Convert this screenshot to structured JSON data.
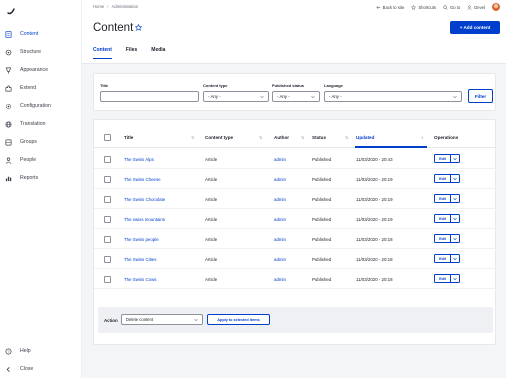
{
  "sidebar": {
    "items": [
      {
        "label": "Content",
        "icon": "file-icon",
        "active": true
      },
      {
        "label": "Structure",
        "icon": "structure-icon",
        "active": false
      },
      {
        "label": "Appearance",
        "icon": "brush-icon",
        "active": false
      },
      {
        "label": "Extend",
        "icon": "puzzle-icon",
        "active": false
      },
      {
        "label": "Configuration",
        "icon": "wrench-icon",
        "active": false
      },
      {
        "label": "Translation",
        "icon": "globe-icon",
        "active": false
      },
      {
        "label": "Groups",
        "icon": "groups-icon",
        "active": false
      },
      {
        "label": "People",
        "icon": "person-icon",
        "active": false
      },
      {
        "label": "Reports",
        "icon": "chart-icon",
        "active": false
      }
    ],
    "bottom": [
      {
        "label": "Help",
        "icon": "help-icon"
      },
      {
        "label": "Close",
        "icon": "close-icon"
      }
    ]
  },
  "topbar": {
    "breadcrumb": [
      "Home",
      "›",
      "Administration"
    ],
    "back_to_site": "Back to site",
    "shortcuts": "Shortcuts",
    "goto": "Go to",
    "user": "Devel"
  },
  "header": {
    "title": "Content",
    "add_button": "+ Add content",
    "tabs": [
      "Content",
      "Files",
      "Media"
    ]
  },
  "filters": {
    "title_label": "Title",
    "title_value": "",
    "content_type_label": "Content type",
    "content_type_value": "- Any -",
    "published_label": "Published status",
    "published_value": "- Any -",
    "language_label": "Language",
    "language_value": "- Any -",
    "filter_button": "Filter"
  },
  "table": {
    "columns": [
      "Title",
      "Content type",
      "Author",
      "Status",
      "Updated",
      "Operations"
    ],
    "sorted_arrow": "↑",
    "rows": [
      {
        "title": "The Swiss Alps",
        "type": "Article",
        "author": "admin",
        "status": "Published",
        "updated": "11/03/2020 - 20:43",
        "op": "Edit"
      },
      {
        "title": "The Swiss Cheese",
        "type": "Article",
        "author": "admin",
        "status": "Published",
        "updated": "11/03/2020 - 20:19",
        "op": "Edit"
      },
      {
        "title": "The Swiss Chocolate",
        "type": "Article",
        "author": "admin",
        "status": "Published",
        "updated": "11/03/2020 - 20:19",
        "op": "Edit"
      },
      {
        "title": "The swiss mountains",
        "type": "Article",
        "author": "admin",
        "status": "Published",
        "updated": "11/03/2020 - 20:19",
        "op": "Edit"
      },
      {
        "title": "The Swiss people",
        "type": "Article",
        "author": "admin",
        "status": "Published",
        "updated": "11/03/2020 - 20:18",
        "op": "Edit"
      },
      {
        "title": "The Swiss Cities",
        "type": "Article",
        "author": "admin",
        "status": "Published",
        "updated": "11/03/2020 - 20:18",
        "op": "Edit"
      },
      {
        "title": "The Swiss Cows",
        "type": "Article",
        "author": "admin",
        "status": "Published",
        "updated": "11/03/2020 - 20:18",
        "op": "Edit"
      }
    ]
  },
  "bulk": {
    "action_label": "Action",
    "action_value": "Delete content",
    "apply_button": "Apply to selected items"
  },
  "colors": {
    "accent": "#003ecc",
    "background": "#f4f5f7"
  }
}
